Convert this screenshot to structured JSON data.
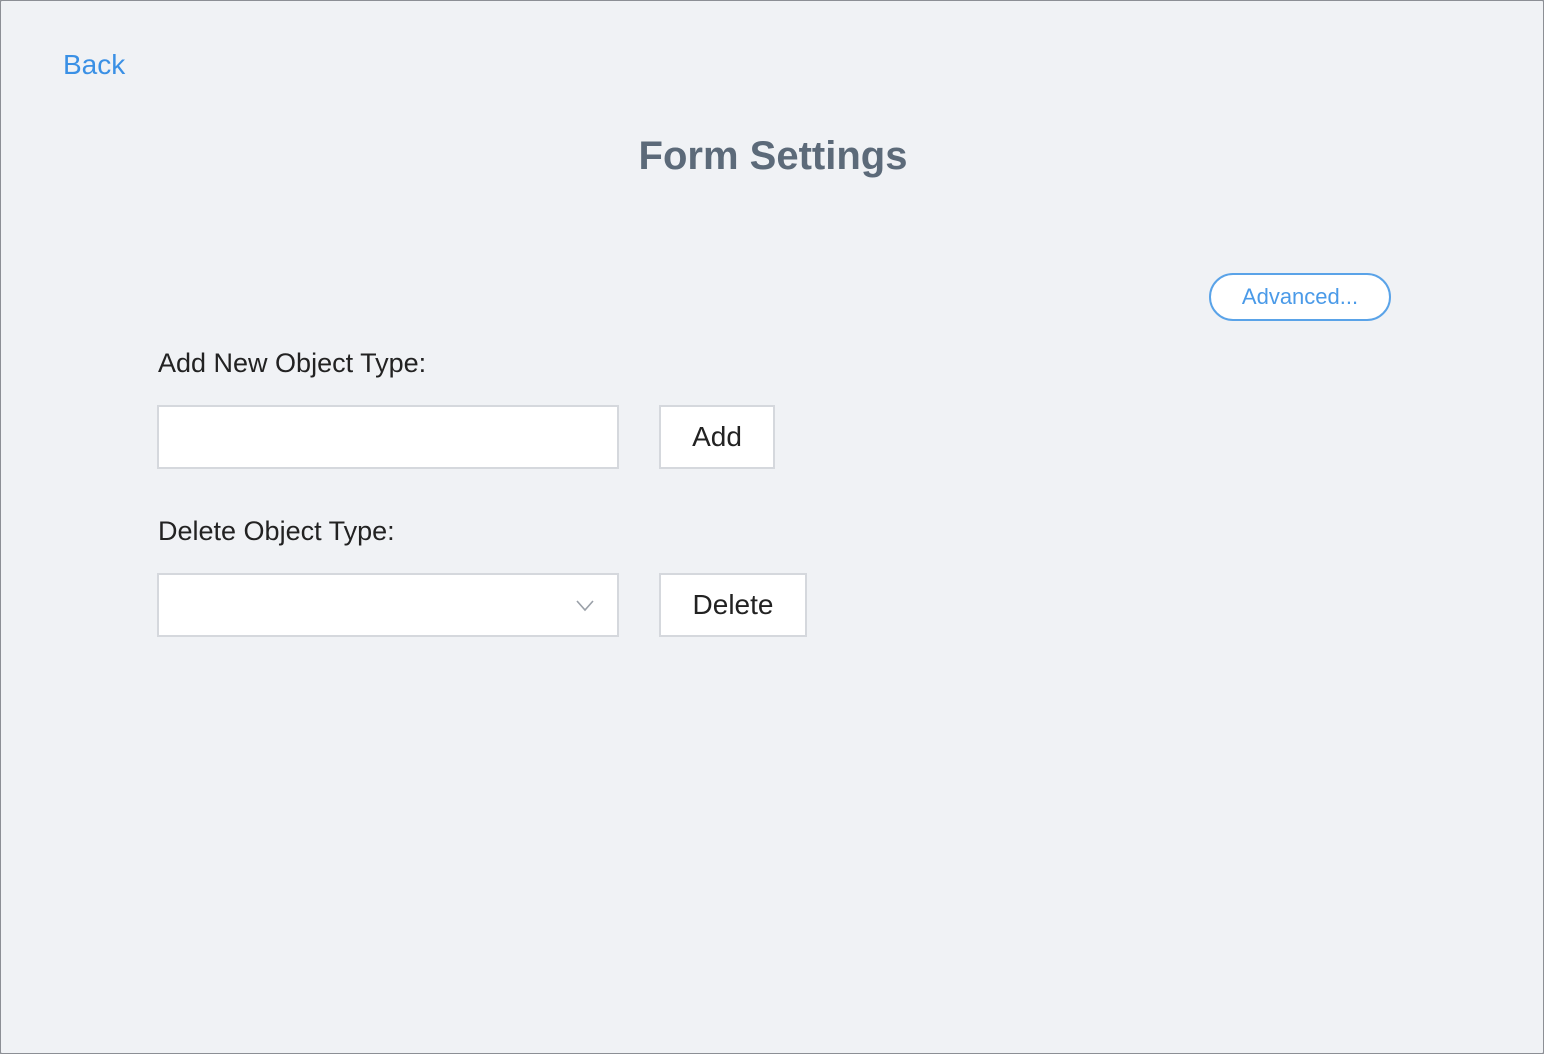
{
  "nav": {
    "back_label": "Back"
  },
  "page": {
    "title": "Form Settings"
  },
  "actions": {
    "advanced_label": "Advanced..."
  },
  "add_section": {
    "label": "Add New Object Type:",
    "input_value": "",
    "input_placeholder": "",
    "button_label": "Add"
  },
  "delete_section": {
    "label": "Delete Object Type:",
    "selected_value": "",
    "button_label": "Delete"
  },
  "colors": {
    "background": "#f0f2f5",
    "link": "#3a90e5",
    "title": "#5c6a79",
    "advanced_border": "#5aa3e8",
    "control_border": "#d5d8dd"
  },
  "icons": {
    "dropdown": "chevron-down-icon"
  }
}
